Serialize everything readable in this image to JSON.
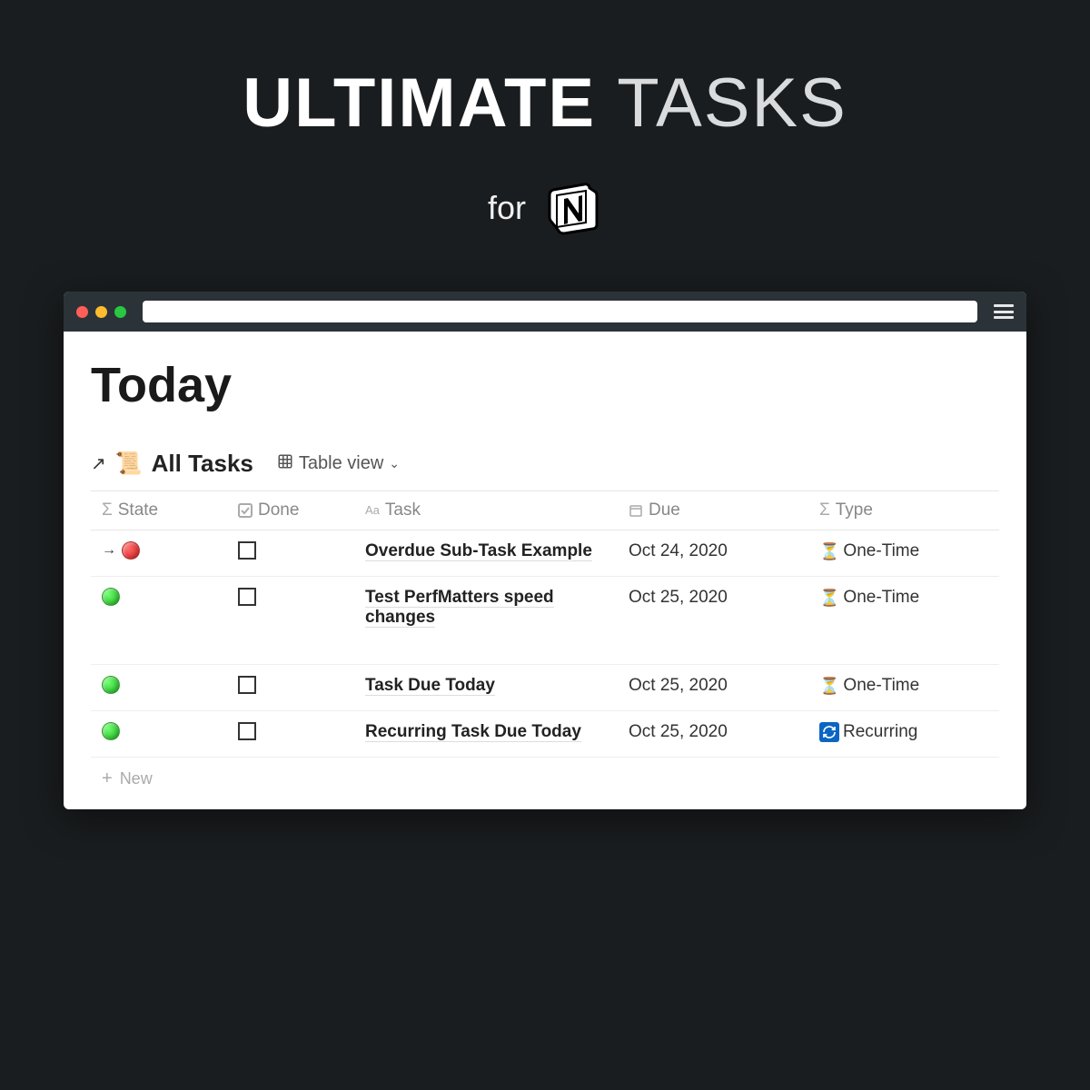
{
  "hero": {
    "title_bold": "ULTIMATE",
    "title_thin": "TASKS",
    "for_label": "for"
  },
  "page": {
    "heading": "Today"
  },
  "database": {
    "title": "All Tasks",
    "view_label": "Table view",
    "scroll_emoji": "scroll-icon"
  },
  "columns": {
    "state": "State",
    "done": "Done",
    "task": "Task",
    "due": "Due",
    "type": "Type"
  },
  "rows": [
    {
      "state": {
        "sub": true,
        "color": "red"
      },
      "done": false,
      "task": "Overdue Sub-Task Example",
      "due": "Oct 24, 2020",
      "type": {
        "icon": "hourglass",
        "label": "One-Time"
      }
    },
    {
      "state": {
        "sub": false,
        "color": "green"
      },
      "done": false,
      "task": "Test PerfMatters speed changes",
      "due": "Oct 25, 2020",
      "type": {
        "icon": "hourglass",
        "label": "One-Time"
      }
    },
    {
      "state": {
        "sub": false,
        "color": "green"
      },
      "done": false,
      "task": "Task Due Today",
      "due": "Oct 25, 2020",
      "type": {
        "icon": "hourglass",
        "label": "One-Time"
      }
    },
    {
      "state": {
        "sub": false,
        "color": "green"
      },
      "done": false,
      "task": "Recurring Task Due Today",
      "due": "Oct 25, 2020",
      "type": {
        "icon": "recurring",
        "label": "Recurring"
      }
    }
  ],
  "new_row_label": "New"
}
